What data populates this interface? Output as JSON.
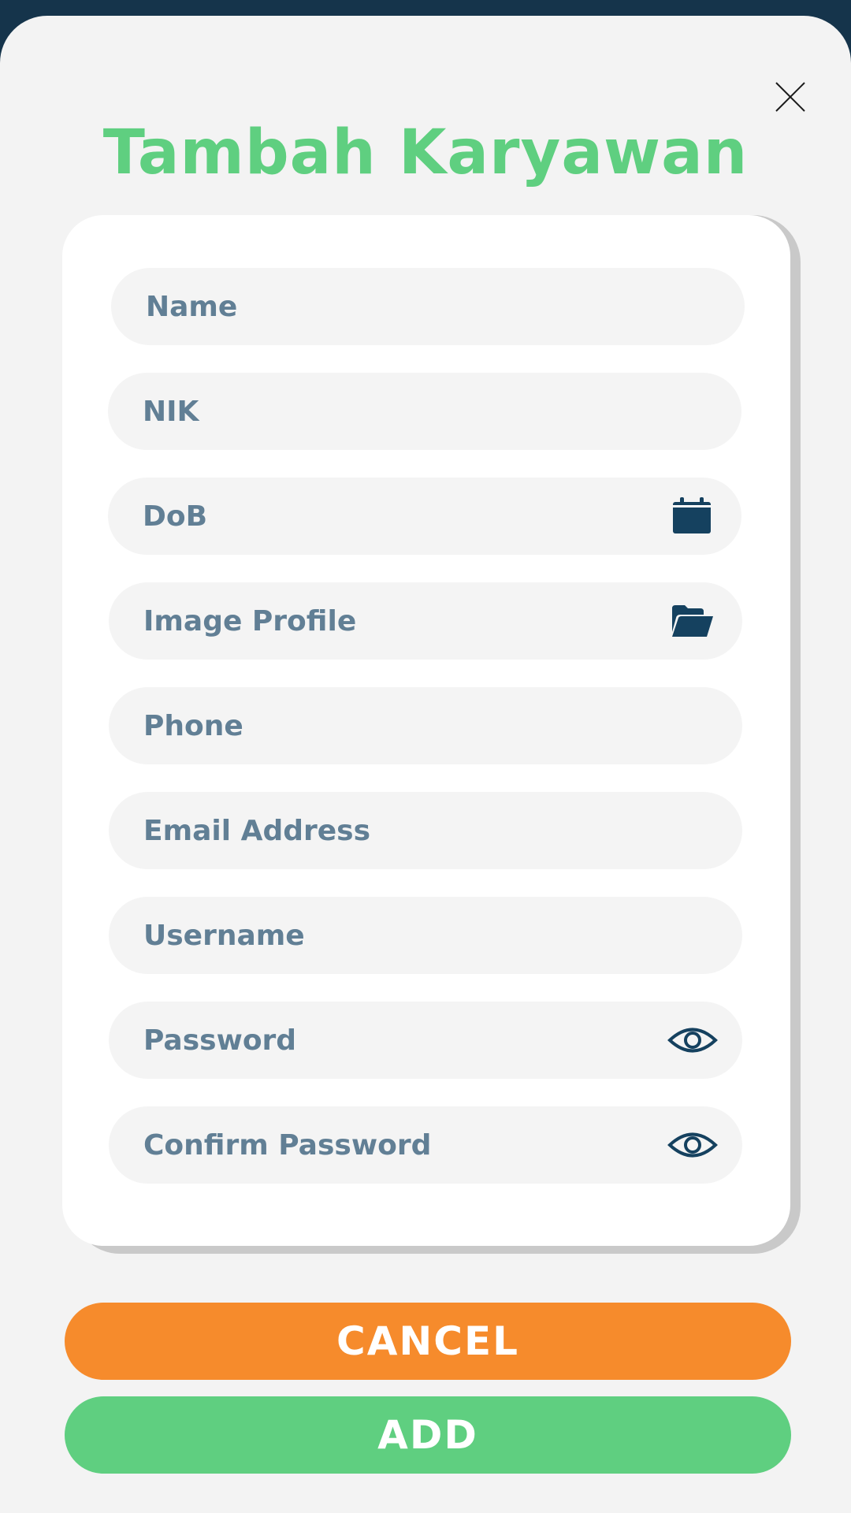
{
  "colors": {
    "top_bar": "#15344b",
    "background": "#f3f3f3",
    "title": "#5fcf80",
    "field_bg": "#f4f4f4",
    "field_text": "#617f95",
    "icon": "#15415f",
    "cancel": "#f68b2c",
    "add": "#5fcf80"
  },
  "header": {
    "title": "Tambah Karyawan",
    "close_icon": "close-icon"
  },
  "form": {
    "fields": [
      {
        "placeholder": "Name"
      },
      {
        "placeholder": "NIK"
      },
      {
        "placeholder": "DoB",
        "icon": "calendar-icon"
      },
      {
        "placeholder": "Image Profile",
        "icon": "folder-icon"
      },
      {
        "placeholder": "Phone"
      },
      {
        "placeholder": "Email Address"
      },
      {
        "placeholder": "Username"
      },
      {
        "placeholder": "Password",
        "icon": "eye-icon"
      },
      {
        "placeholder": "Confirm Password",
        "icon": "eye-icon"
      }
    ]
  },
  "actions": {
    "cancel_label": "CANCEL",
    "add_label": "ADD"
  }
}
